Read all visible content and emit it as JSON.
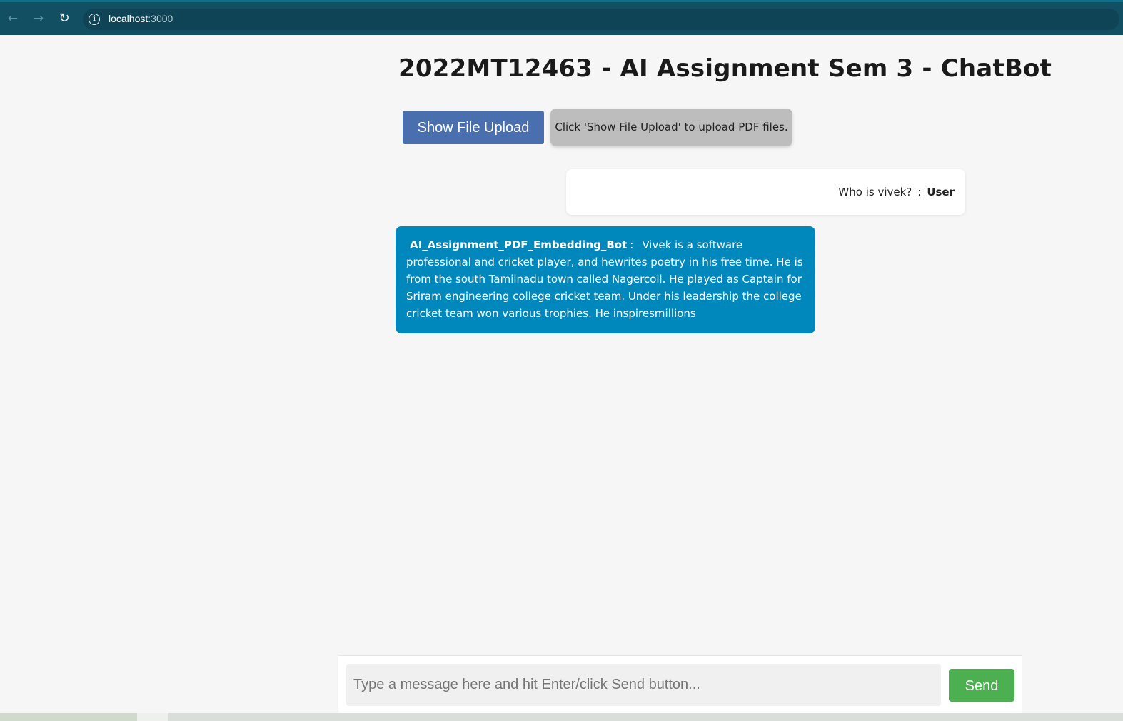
{
  "browser": {
    "back_icon": "←",
    "forward_icon": "→",
    "reload_icon": "↻",
    "url_host": "localhost",
    "url_port": ":3000"
  },
  "page": {
    "title": "2022MT12463 - AI Assignment Sem 3 - ChatBot"
  },
  "upload": {
    "button_label": "Show File Upload",
    "hint": "Click 'Show File Upload' to upload PDF files."
  },
  "messages": [
    {
      "sender": "User",
      "text": "Who is vivek?",
      "separator": ":"
    },
    {
      "sender": "AI_Assignment_PDF_Embedding_Bot",
      "separator": ":",
      "text": "Vivek is a software professional and cricket player, and hewrites poetry in his free time. He is from the south Tamilnadu town called Nagercoil. He played as Captain for Sriram engineering college cricket team. Under his leadership the college cricket team won various trophies. He inspiresmillions"
    }
  ],
  "composer": {
    "placeholder": "Type a message here and hit Enter/click Send button...",
    "value": "",
    "send_label": "Send"
  },
  "colors": {
    "browser_bar": "#134f63",
    "upload_button": "#4a6fae",
    "bot_bubble": "#0088bc",
    "send_button": "#4caf50"
  }
}
